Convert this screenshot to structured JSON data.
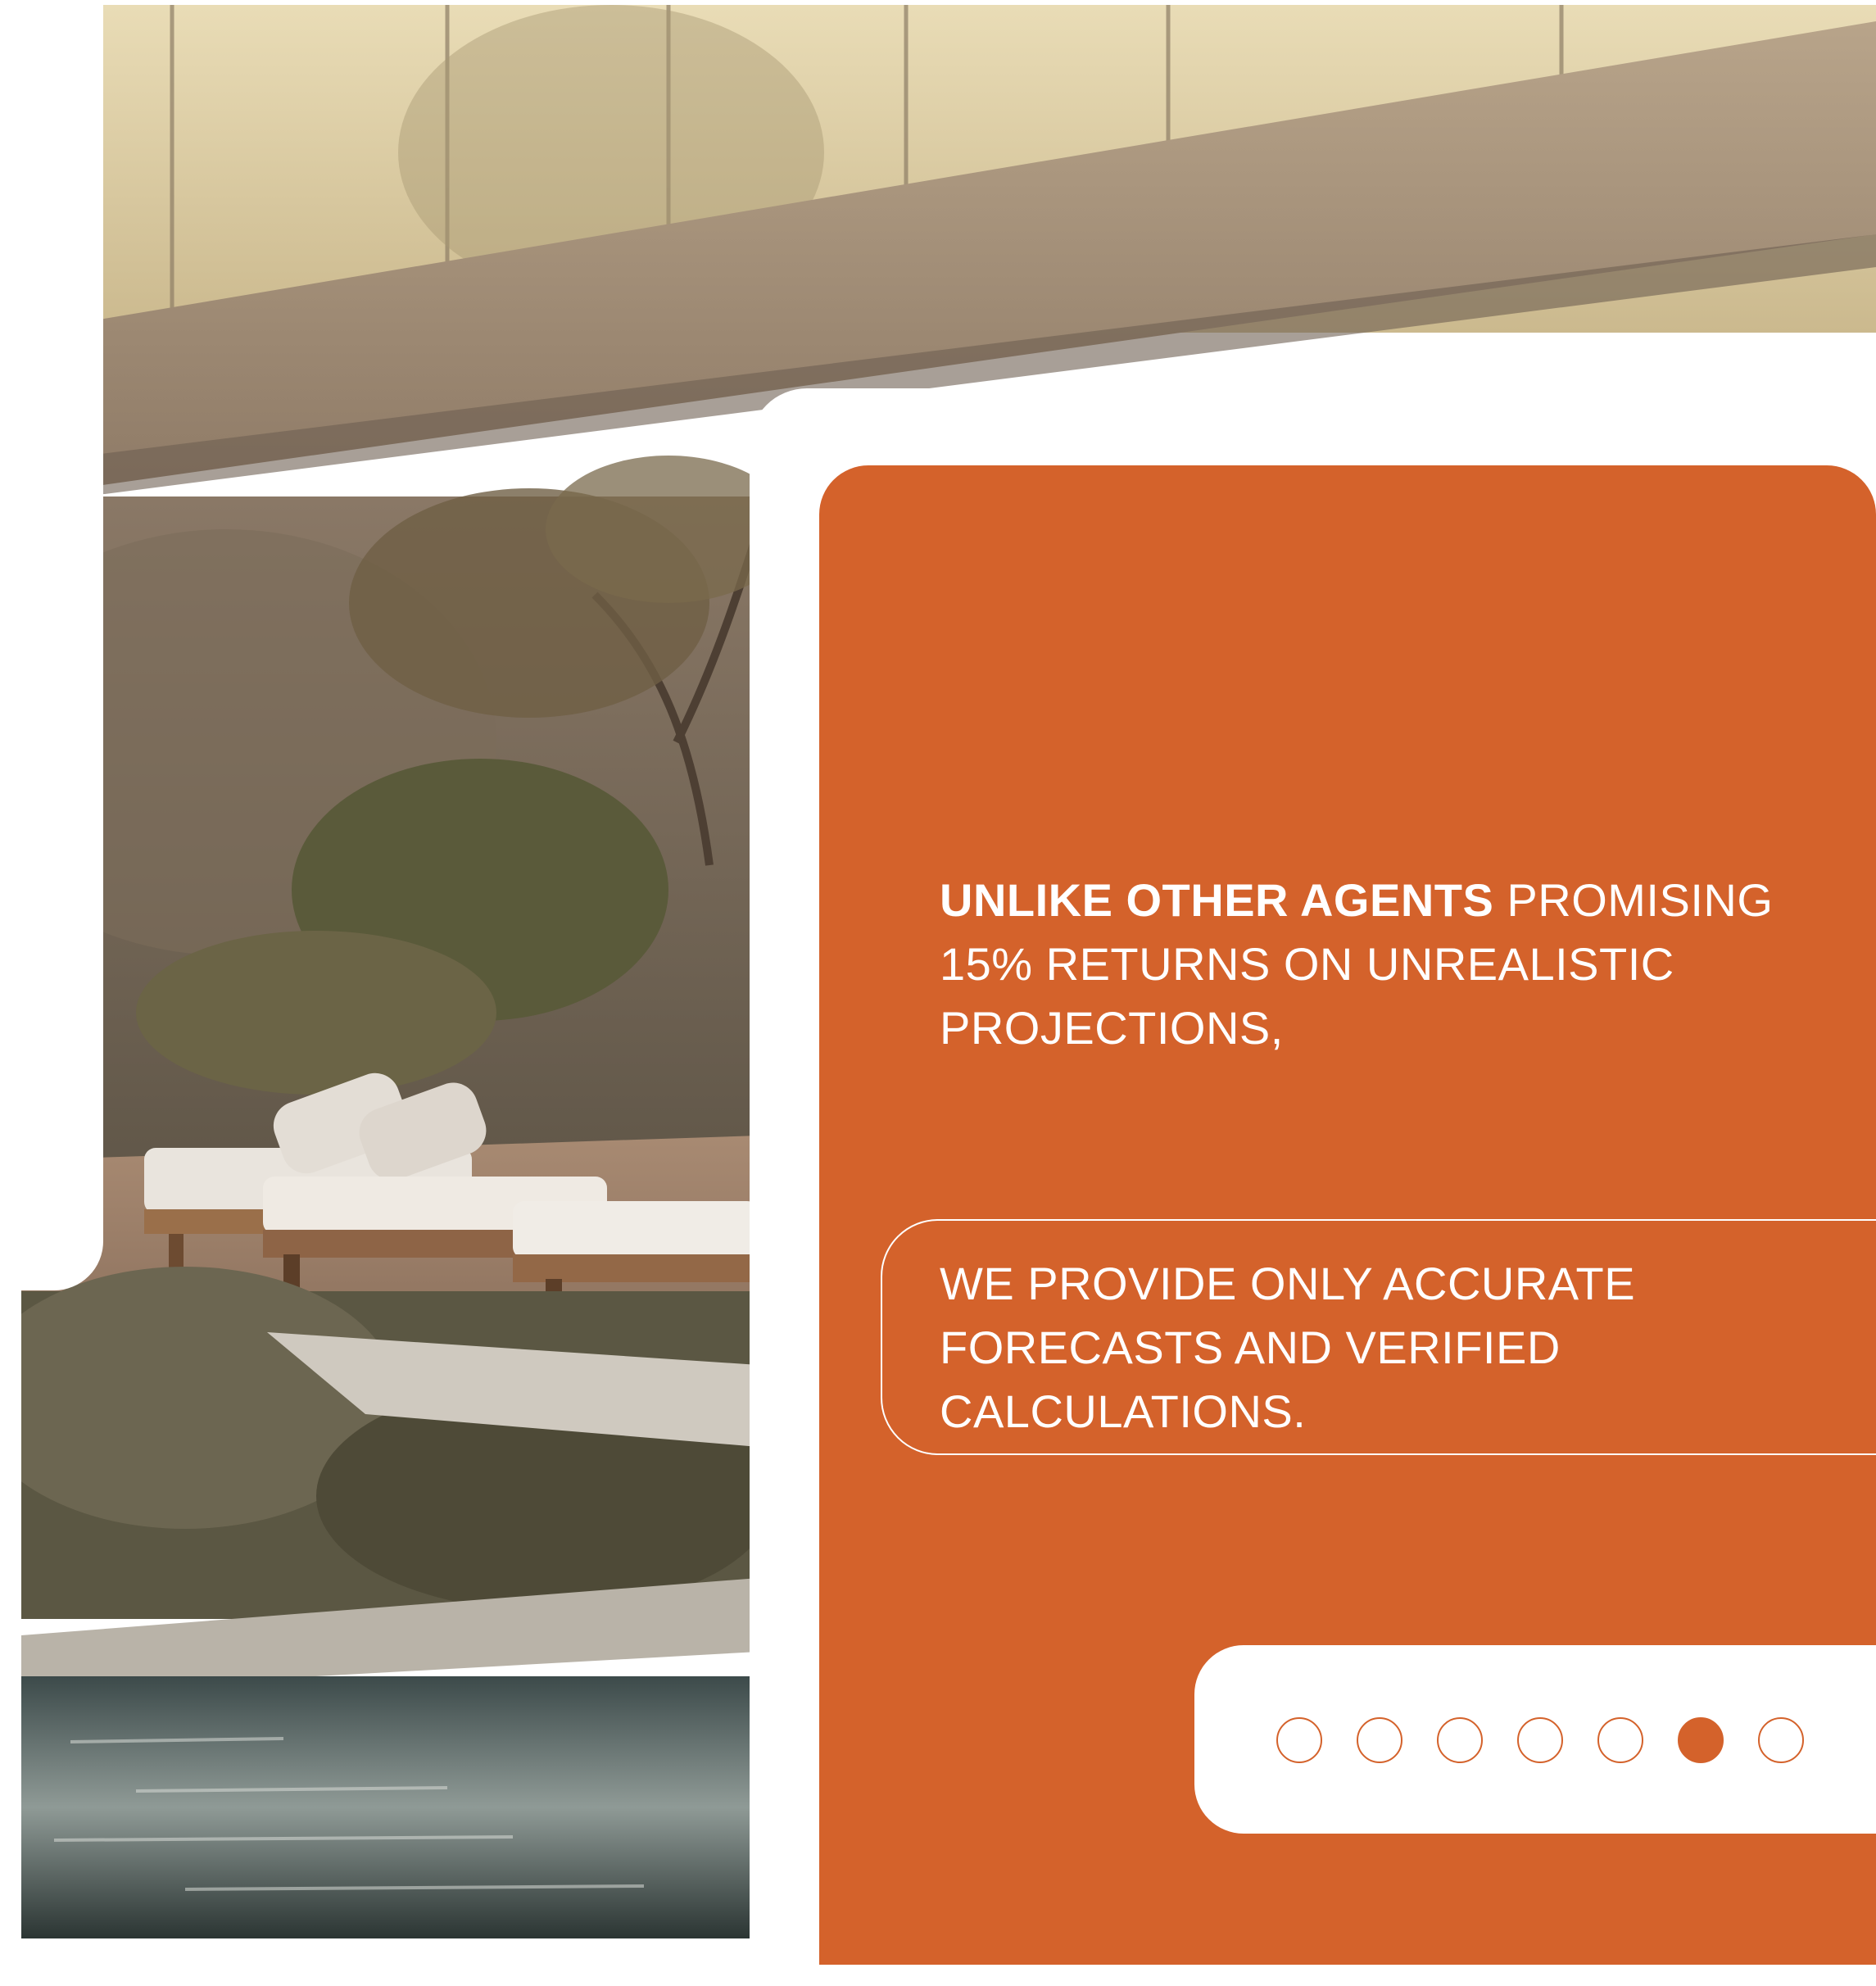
{
  "colors": {
    "accent": "#d4622b",
    "text_on_accent": "#ffffff",
    "background": "#ffffff"
  },
  "hero_image": {
    "icon": "villa-pool-photo"
  },
  "panel": {
    "headline_bold": "UNLIKE OTHER AGENTS",
    "headline_rest": " PROMISING 15% RETURNS ON UNREALISTIC PROJECTIONS,",
    "subline": "WE PROVIDE ONLY ACCURATE FORECASTS AND VERIFIED CALCULATIONS."
  },
  "pager": {
    "total": 7,
    "active_index": 5
  }
}
